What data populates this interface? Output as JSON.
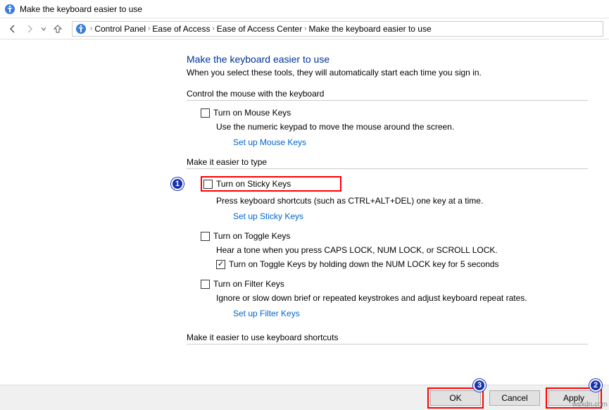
{
  "title": "Make the keyboard easier to use",
  "breadcrumb": {
    "items": [
      "Control Panel",
      "Ease of Access",
      "Ease of Access Center",
      "Make the keyboard easier to use"
    ]
  },
  "page": {
    "heading": "Make the keyboard easier to use",
    "sub": "When you select these tools, they will automatically start each time you sign in.",
    "section1": {
      "title": "Control the mouse with the keyboard",
      "mouseKeys": {
        "label": "Turn on Mouse Keys",
        "desc": "Use the numeric keypad to move the mouse around the screen.",
        "link": "Set up Mouse Keys"
      }
    },
    "section2": {
      "title": "Make it easier to type",
      "stickyKeys": {
        "label": "Turn on Sticky Keys",
        "desc": "Press keyboard shortcuts (such as CTRL+ALT+DEL) one key at a time.",
        "link": "Set up Sticky Keys"
      },
      "toggleKeys": {
        "label": "Turn on Toggle Keys",
        "desc": "Hear a tone when you press CAPS LOCK, NUM LOCK, or SCROLL LOCK.",
        "subOption": "Turn on Toggle Keys by holding down the NUM LOCK key for 5 seconds"
      },
      "filterKeys": {
        "label": "Turn on Filter Keys",
        "desc": "Ignore or slow down brief or repeated keystrokes and adjust keyboard repeat rates.",
        "link": "Set up Filter Keys"
      }
    },
    "section3": {
      "title": "Make it easier to use keyboard shortcuts"
    }
  },
  "buttons": {
    "ok": "OK",
    "cancel": "Cancel",
    "apply": "Apply"
  },
  "markers": {
    "m1": "1",
    "m2": "2",
    "m3": "3"
  },
  "watermark": "wsxdn.com"
}
